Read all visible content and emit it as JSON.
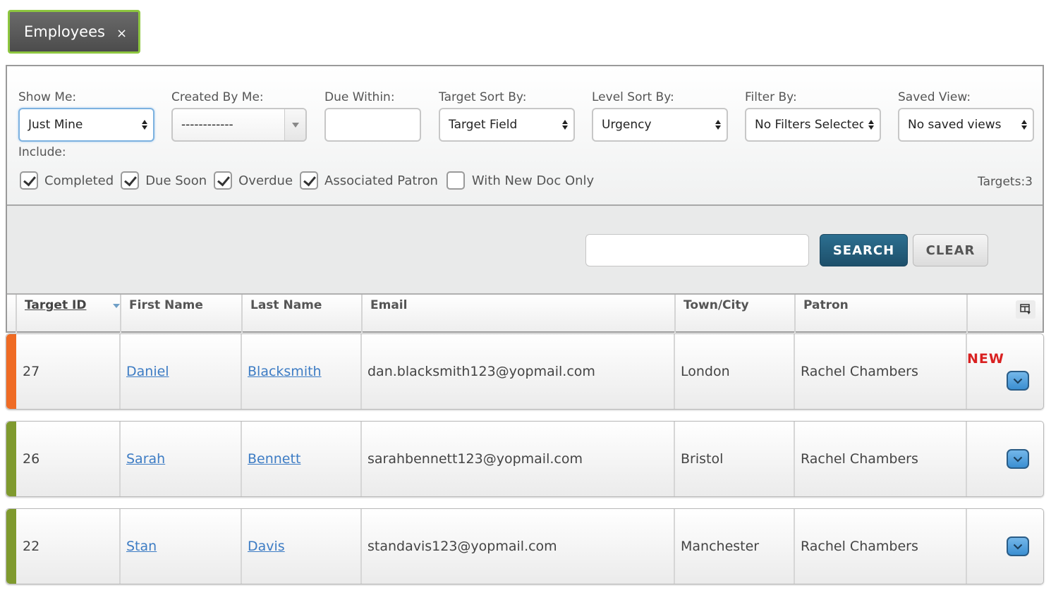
{
  "tab": {
    "label": "Employees",
    "close": "×"
  },
  "filters": {
    "show_me": {
      "label": "Show Me:",
      "value": "Just Mine"
    },
    "created_by_me": {
      "label": "Created By Me:",
      "value": "------------"
    },
    "due_within": {
      "label": "Due Within:",
      "value": ""
    },
    "target_sort_by": {
      "label": "Target Sort By:",
      "value": "Target Field"
    },
    "level_sort_by": {
      "label": "Level Sort By:",
      "value": "Urgency"
    },
    "filter_by": {
      "label": "Filter By:",
      "value": "No Filters Selected"
    },
    "saved_view": {
      "label": "Saved View:",
      "value": "No saved views"
    }
  },
  "include": {
    "label": "Include:",
    "options": [
      {
        "label": "Completed",
        "checked": true
      },
      {
        "label": "Due Soon",
        "checked": true
      },
      {
        "label": "Overdue",
        "checked": true
      },
      {
        "label": "Associated Patron",
        "checked": true
      },
      {
        "label": "With New Doc Only",
        "checked": false
      }
    ]
  },
  "targets_count": "Targets:3",
  "search": {
    "value": "",
    "search_label": "SEARCH",
    "clear_label": "CLEAR"
  },
  "table": {
    "columns": [
      "Target ID",
      "First Name",
      "Last Name",
      "Email",
      "Town/City",
      "Patron"
    ],
    "rows": [
      {
        "id": "27",
        "first": "Daniel",
        "last": "Blacksmith",
        "email": "dan.blacksmith123@yopmail.com",
        "town": "London",
        "patron": "Rachel Chambers",
        "badge": "NEW",
        "status_color": "#ef6b24"
      },
      {
        "id": "26",
        "first": "Sarah",
        "last": "Bennett",
        "email": "sarahbennett123@yopmail.com",
        "town": "Bristol",
        "patron": "Rachel Chambers",
        "badge": "",
        "status_color": "#7f9a2e"
      },
      {
        "id": "22",
        "first": "Stan",
        "last": "Davis",
        "email": "standavis123@yopmail.com",
        "town": "Manchester",
        "patron": "Rachel Chambers",
        "badge": "",
        "status_color": "#7f9a2e"
      }
    ]
  },
  "colors": {
    "tab_border": "#8dc63f",
    "search_button": "#246384",
    "link": "#3d7cc4",
    "new_badge": "#d92121"
  }
}
